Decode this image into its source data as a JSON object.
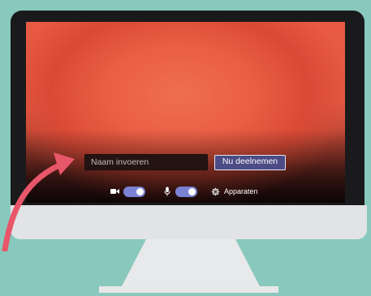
{
  "join_screen": {
    "name_input": {
      "value": "",
      "placeholder": "Naam invoeren"
    },
    "join_button_label": "Nu deelnemen",
    "video_toggle": {
      "icon": "video-camera-icon",
      "on": true
    },
    "mic_toggle": {
      "icon": "microphone-icon",
      "on": true
    },
    "devices": {
      "icon": "gear-icon",
      "label": "Apparaten"
    }
  },
  "colors": {
    "background": "#89c9bd",
    "accent_button": "#4b4b86",
    "toggle_on": "#7b81d3",
    "arrow": "#e8566a",
    "camera_preview": "#e85a44"
  }
}
